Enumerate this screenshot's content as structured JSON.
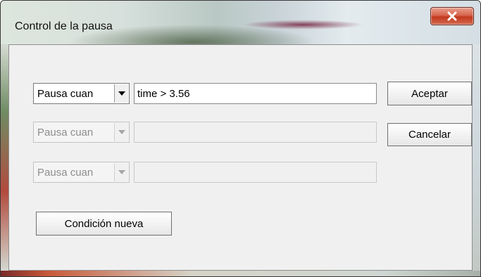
{
  "window": {
    "title": "Control de la pausa",
    "close_label": "x"
  },
  "conditions": [
    {
      "mode": "Pausa cuan",
      "expression": "time > 3.56",
      "enabled": true
    },
    {
      "mode": "Pausa cuan",
      "expression": "",
      "enabled": false
    },
    {
      "mode": "Pausa cuan",
      "expression": "",
      "enabled": false
    }
  ],
  "buttons": {
    "accept": "Aceptar",
    "cancel": "Cancelar",
    "new_condition": "Condición nueva"
  },
  "icons": {
    "close": "close-x-icon",
    "dropdown": "chevron-down-icon"
  },
  "colors": {
    "dialog_bg": "#f0f0f0",
    "close_red": "#c2391f"
  }
}
